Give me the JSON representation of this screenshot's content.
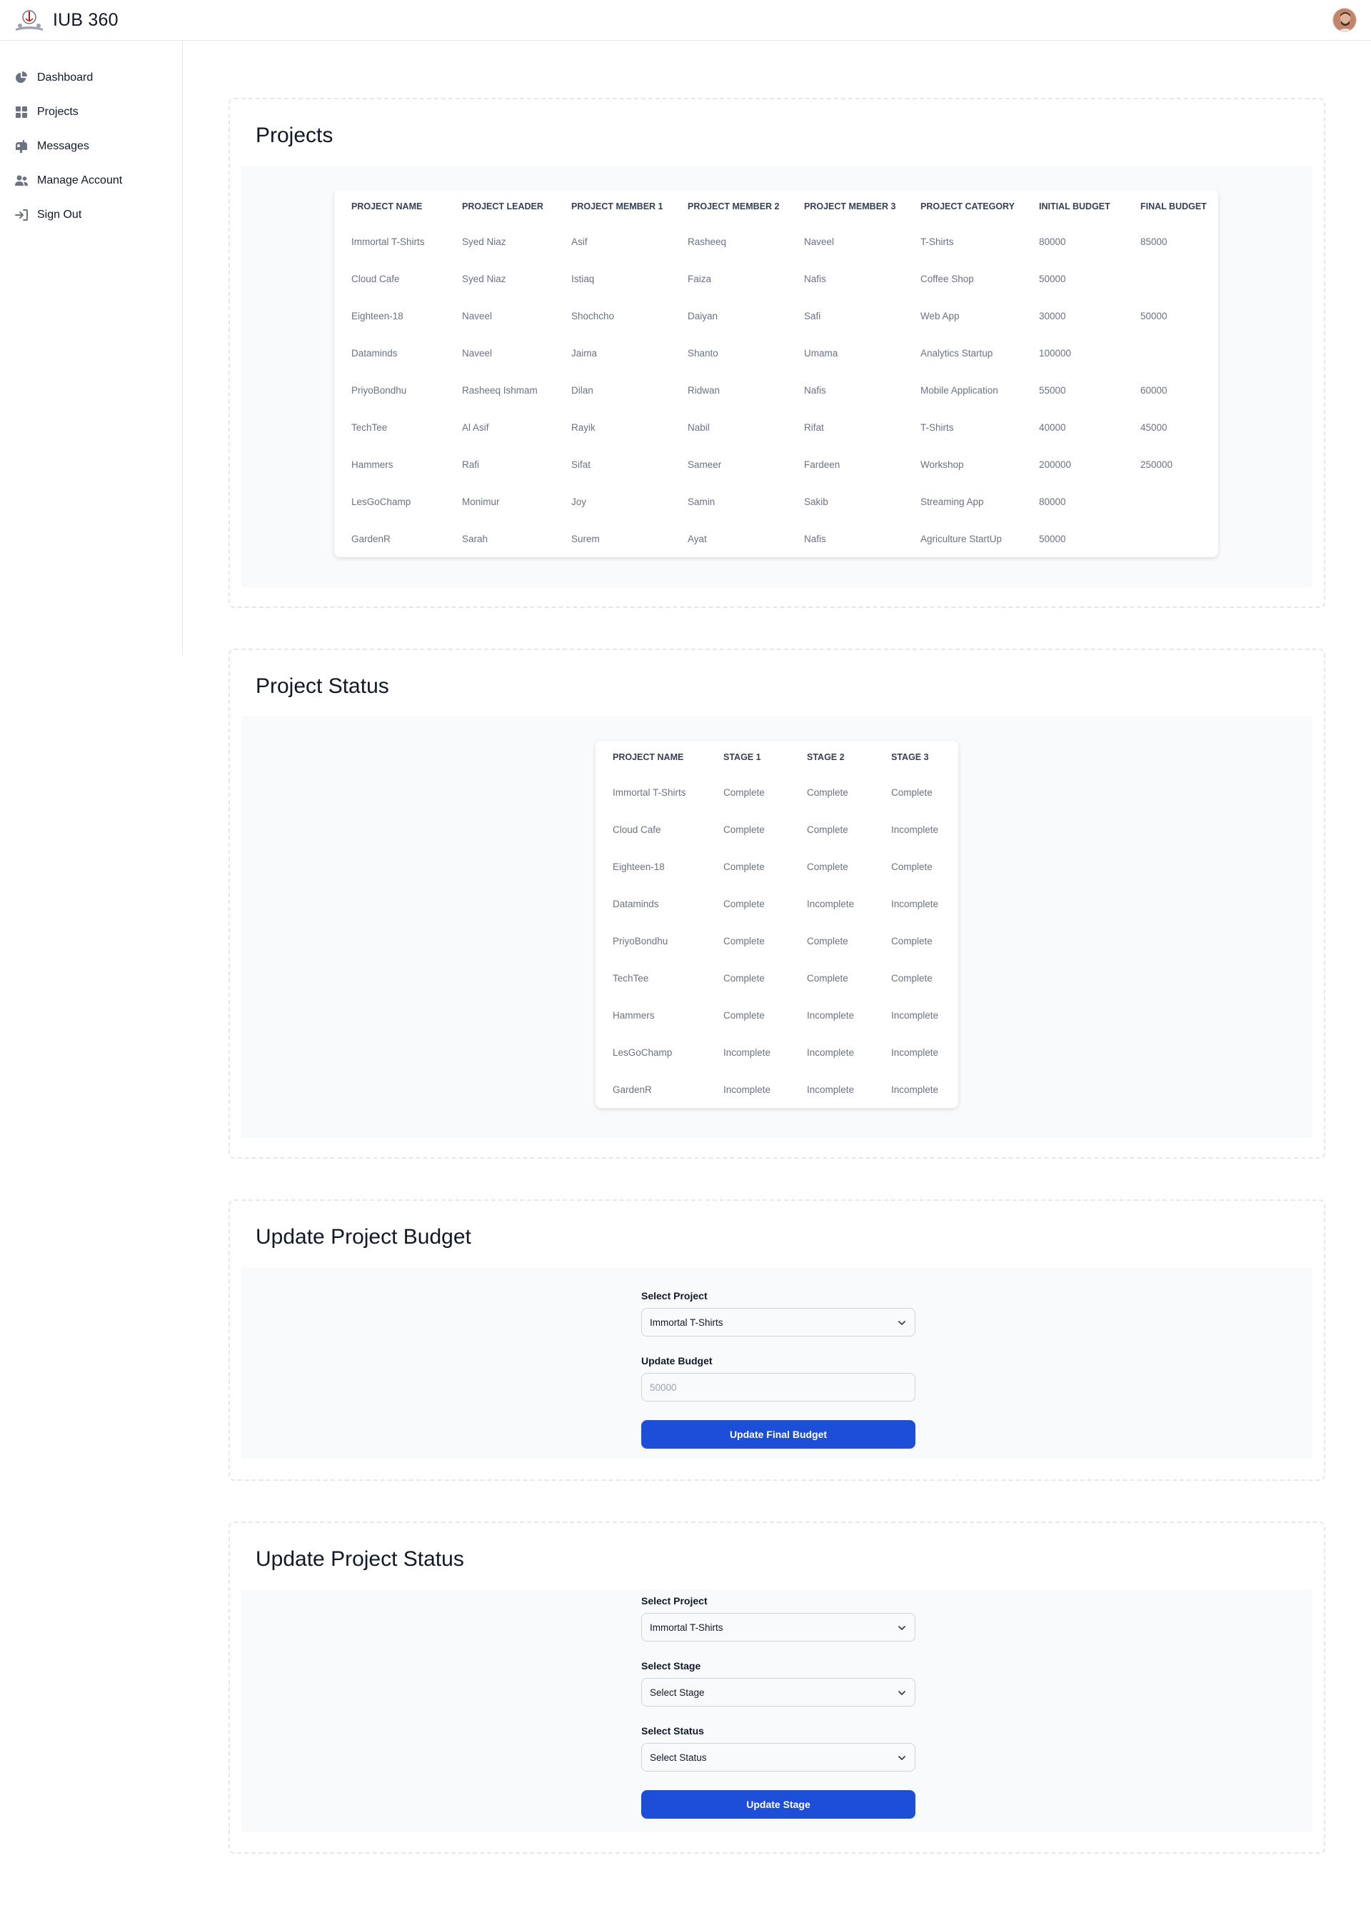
{
  "app": {
    "title": "IUB 360"
  },
  "sidebar": {
    "items": [
      {
        "label": "Dashboard",
        "icon": "pie-chart-icon"
      },
      {
        "label": "Projects",
        "icon": "grid-icon"
      },
      {
        "label": "Messages",
        "icon": "mailbox-icon"
      },
      {
        "label": "Manage Account",
        "icon": "users-icon"
      },
      {
        "label": "Sign Out",
        "icon": "sign-out-icon"
      }
    ]
  },
  "projects": {
    "title": "Projects",
    "columns": [
      "Project Name",
      "Project Leader",
      "Project Member 1",
      "Project Member 2",
      "Project Member 3",
      "Project Category",
      "Initial Budget",
      "Final Budget"
    ],
    "rows": [
      [
        "Immortal T-Shirts",
        "Syed Niaz",
        "Asif",
        "Rasheeq",
        "Naveel",
        "T-Shirts",
        "80000",
        "85000"
      ],
      [
        "Cloud Cafe",
        "Syed Niaz",
        "Istiaq",
        "Faiza",
        "Nafis",
        "Coffee Shop",
        "50000",
        ""
      ],
      [
        "Eighteen-18",
        "Naveel",
        "Shochcho",
        "Daiyan",
        "Safi",
        "Web App",
        "30000",
        "50000"
      ],
      [
        "Dataminds",
        "Naveel",
        "Jaima",
        "Shanto",
        "Umama",
        "Analytics Startup",
        "100000",
        ""
      ],
      [
        "PriyoBondhu",
        "Rasheeq Ishmam",
        "Dilan",
        "Ridwan",
        "Nafis",
        "Mobile Application",
        "55000",
        "60000"
      ],
      [
        "TechTee",
        "Al Asif",
        "Rayik",
        "Nabil",
        "Rifat",
        "T-Shirts",
        "40000",
        "45000"
      ],
      [
        "Hammers",
        "Rafi",
        "Sifat",
        "Sameer",
        "Fardeen",
        "Workshop",
        "200000",
        "250000"
      ],
      [
        "LesGoChamp",
        "Monimur",
        "Joy",
        "Samin",
        "Sakib",
        "Streaming App",
        "80000",
        ""
      ],
      [
        "GardenR",
        "Sarah",
        "Surem",
        "Ayat",
        "Nafis",
        "Agriculture StartUp",
        "50000",
        ""
      ]
    ]
  },
  "status": {
    "title": "Project Status",
    "columns": [
      "Project Name",
      "Stage 1",
      "Stage 2",
      "Stage 3"
    ],
    "rows": [
      [
        "Immortal T-Shirts",
        "Complete",
        "Complete",
        "Complete"
      ],
      [
        "Cloud Cafe",
        "Complete",
        "Complete",
        "Incomplete"
      ],
      [
        "Eighteen-18",
        "Complete",
        "Complete",
        "Complete"
      ],
      [
        "Dataminds",
        "Complete",
        "Incomplete",
        "Incomplete"
      ],
      [
        "PriyoBondhu",
        "Complete",
        "Complete",
        "Complete"
      ],
      [
        "TechTee",
        "Complete",
        "Complete",
        "Complete"
      ],
      [
        "Hammers",
        "Complete",
        "Incomplete",
        "Incomplete"
      ],
      [
        "LesGoChamp",
        "Incomplete",
        "Incomplete",
        "Incomplete"
      ],
      [
        "GardenR",
        "Incomplete",
        "Incomplete",
        "Incomplete"
      ]
    ]
  },
  "budget_form": {
    "title": "Update Project Budget",
    "select_label": "Select Project",
    "select_value": "Immortal T-Shirts",
    "budget_label": "Update Budget",
    "budget_placeholder": "50000",
    "button": "Update Final Budget"
  },
  "status_form": {
    "title": "Update Project Status",
    "project_label": "Select Project",
    "project_value": "Immortal T-Shirts",
    "stage_label": "Select Stage",
    "stage_value": "Select Stage",
    "status_label": "Select Status",
    "status_value": "Select Status",
    "button": "Update Stage"
  },
  "colors": {
    "primary": "#1d4ed8",
    "panel": "#f9fafb",
    "border": "#e5e7eb"
  }
}
